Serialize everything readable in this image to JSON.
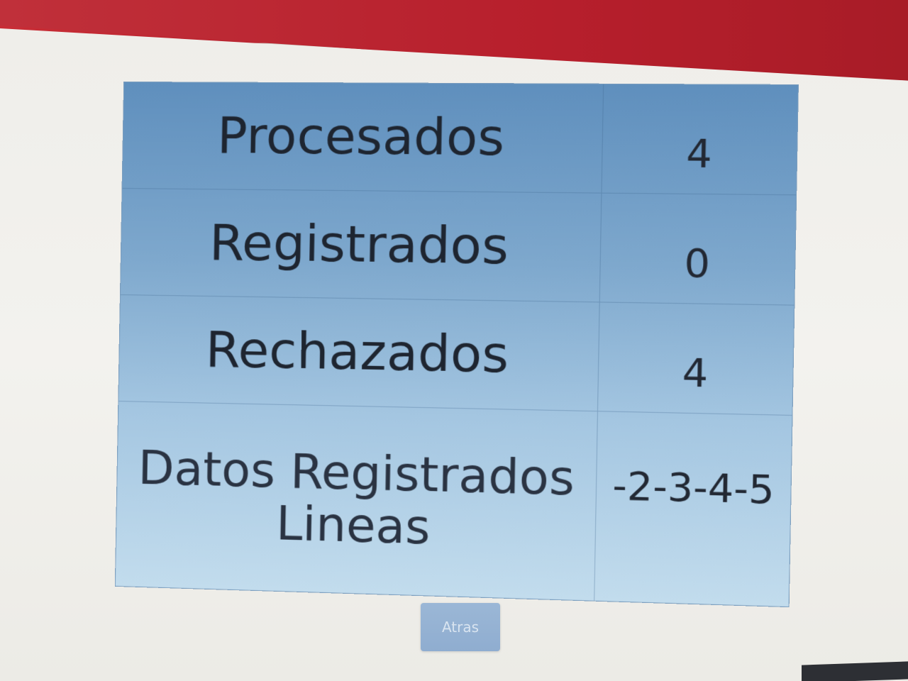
{
  "results": {
    "rows": [
      {
        "label": "Procesados",
        "value": "4"
      },
      {
        "label": "Registrados",
        "value": "0"
      },
      {
        "label": "Rechazados",
        "value": "4"
      },
      {
        "label": "Datos Registrados Lineas",
        "value": "-2-3-4-5"
      }
    ]
  },
  "actions": {
    "back_label": "Atras"
  },
  "colors": {
    "table_top": "#5f8fbd",
    "table_bottom": "#c2dced",
    "button": "#9bb7d6",
    "header_bar": "#b71f2c"
  }
}
